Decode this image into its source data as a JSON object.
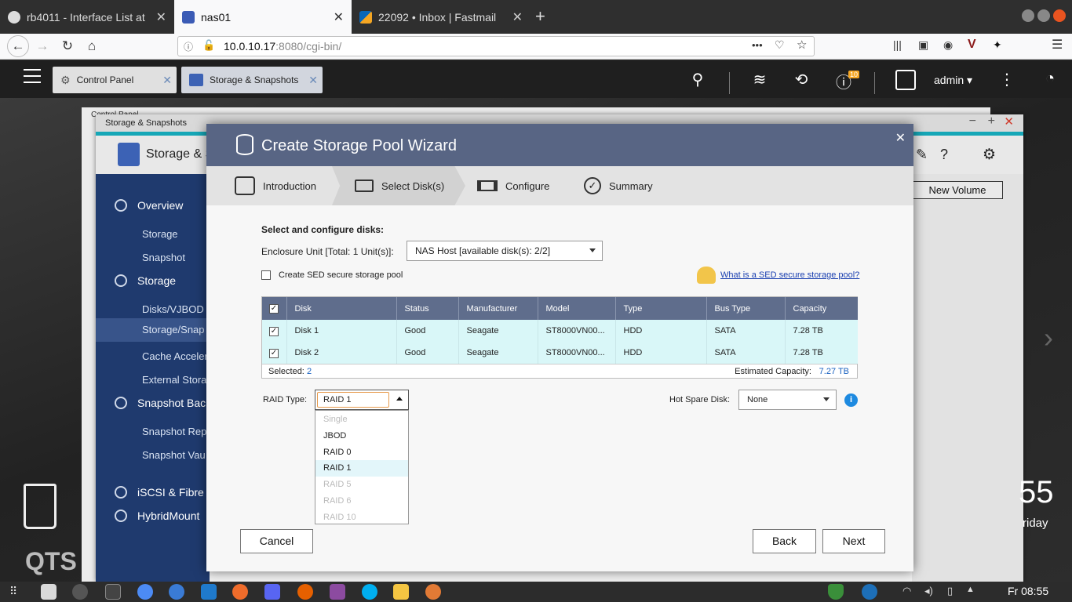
{
  "browser": {
    "tabs": [
      {
        "title": "rb4011 - Interface List at",
        "icon": "router-icon"
      },
      {
        "title": "nas01",
        "icon": "qnap-icon"
      },
      {
        "title": "22092 • Inbox | Fastmail",
        "icon": "mail-icon"
      }
    ],
    "url_host": "10.0.10.17",
    "url_rest": ":8080/cgi-bin/",
    "url_menu": "•••"
  },
  "qts": {
    "tabs": [
      {
        "label": "Control Panel"
      },
      {
        "label": "Storage & Snapshots"
      }
    ],
    "notification_count": "10",
    "user": "admin ▾"
  },
  "background": {
    "window_title_back": "Control Panel",
    "window_title": "Storage & Snapshots",
    "header_title": "Storage & S",
    "new_volume": "New Volume",
    "clock_min": "55",
    "clock_day": "riday",
    "qts_logo": "QTS",
    "sidebar": [
      {
        "label": "Overview",
        "type": "h"
      },
      {
        "label": "Storage",
        "type": "s"
      },
      {
        "label": "Snapshot",
        "type": "s"
      },
      {
        "label": "Storage",
        "type": "h"
      },
      {
        "label": "Disks/VJBOD",
        "type": "s"
      },
      {
        "label": "Storage/Snap",
        "type": "s"
      },
      {
        "label": "Cache Acceler",
        "type": "s"
      },
      {
        "label": "External Stora",
        "type": "s"
      },
      {
        "label": "Snapshot Bac",
        "type": "h"
      },
      {
        "label": "Snapshot Rep",
        "type": "s"
      },
      {
        "label": "Snapshot Vau",
        "type": "s"
      },
      {
        "label": "iSCSI & Fibre",
        "type": "h"
      },
      {
        "label": "HybridMount",
        "type": "h"
      }
    ]
  },
  "wizard": {
    "title": "Create Storage Pool Wizard",
    "steps": [
      "Introduction",
      "Select Disk(s)",
      "Configure",
      "Summary"
    ],
    "section_title": "Select and configure disks:",
    "enclosure_label": "Enclosure Unit [Total: 1 Unit(s)]:",
    "enclosure_value": "NAS Host [available disk(s): 2/2]",
    "sed_label": "Create SED secure storage pool",
    "sed_link": "What is a SED secure storage pool?",
    "columns": [
      "Disk",
      "Status",
      "Manufacturer",
      "Model",
      "Type",
      "Bus Type",
      "Capacity"
    ],
    "rows": [
      [
        "Disk 1",
        "Good",
        "Seagate",
        "ST8000VN00...",
        "HDD",
        "SATA",
        "7.28 TB"
      ],
      [
        "Disk 2",
        "Good",
        "Seagate",
        "ST8000VN00...",
        "HDD",
        "SATA",
        "7.28 TB"
      ]
    ],
    "selected_label": "Selected:",
    "selected_count": "2",
    "estimated_label": "Estimated Capacity:",
    "estimated_value": "7.27 TB",
    "raid_label": "RAID Type:",
    "raid_value": "RAID 1",
    "raid_options": [
      {
        "label": "Single",
        "enabled": false
      },
      {
        "label": "JBOD",
        "enabled": true
      },
      {
        "label": "RAID 0",
        "enabled": true
      },
      {
        "label": "RAID 1",
        "enabled": true
      },
      {
        "label": "RAID 5",
        "enabled": false
      },
      {
        "label": "RAID 6",
        "enabled": false
      },
      {
        "label": "RAID 10",
        "enabled": false
      }
    ],
    "hot_spare_label": "Hot Spare Disk:",
    "hot_spare_value": "None",
    "cancel": "Cancel",
    "back": "Back",
    "next": "Next"
  },
  "taskbar": {
    "clock": "Fr 08:55"
  }
}
